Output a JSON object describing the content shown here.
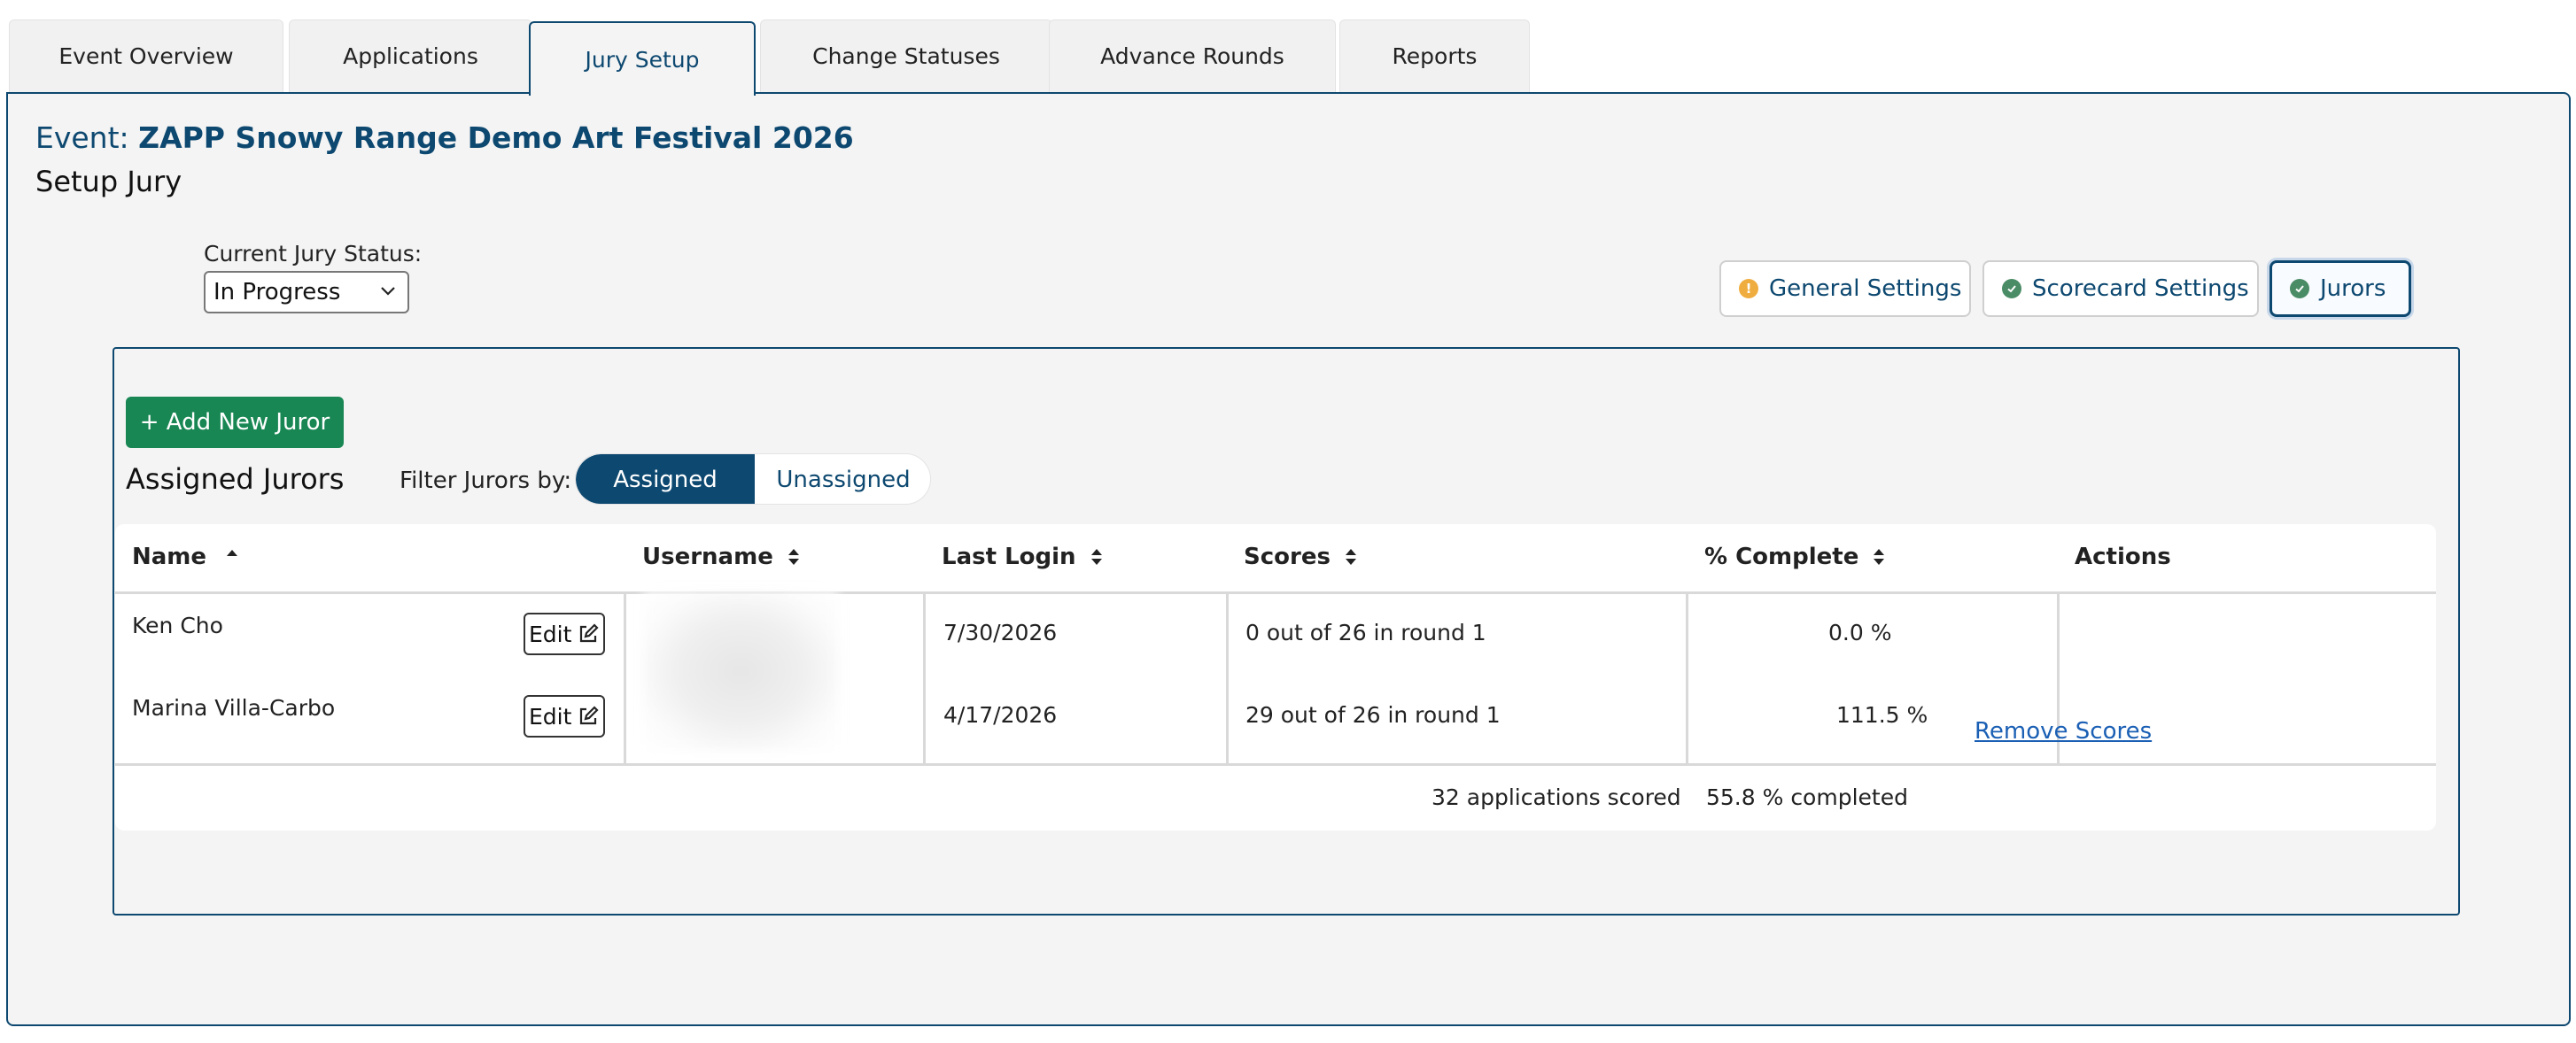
{
  "tabs": [
    {
      "label": "Event Overview"
    },
    {
      "label": "Applications"
    },
    {
      "label": "Jury Setup",
      "active": true
    },
    {
      "label": "Change Statuses"
    },
    {
      "label": "Advance Rounds"
    },
    {
      "label": "Reports"
    }
  ],
  "event": {
    "prefix": "Event:",
    "name": "ZAPP Snowy Range Demo Art Festival 2026",
    "subtitle": "Setup Jury"
  },
  "jury_status": {
    "label": "Current Jury Status:",
    "selected": "In Progress"
  },
  "setting_buttons": [
    {
      "label": "General Settings",
      "status": "warning"
    },
    {
      "label": "Scorecard Settings",
      "status": "complete"
    },
    {
      "label": "Jurors",
      "status": "complete",
      "active": true
    }
  ],
  "jurors": {
    "add_label": "+ Add New Juror",
    "title": "Assigned Jurors",
    "filter_label": "Filter Jurors by:",
    "filter_options": [
      "Assigned",
      "Unassigned"
    ],
    "filter_selected": "Assigned"
  },
  "table": {
    "headers": {
      "name": "Name",
      "username": "Username",
      "last_login": "Last Login",
      "scores": "Scores",
      "complete": "% Complete",
      "actions": "Actions"
    },
    "edit_label": "Edit",
    "rows": [
      {
        "name": "Ken Cho",
        "last_login": "7/30/2026",
        "scores": "0 out of 26 in round 1",
        "complete": "0.0 %",
        "action": ""
      },
      {
        "name": "Marina Villa-Carbo",
        "last_login": "4/17/2026",
        "scores": "29 out of 26 in round 1",
        "complete": "111.5 %",
        "action": "Remove Scores"
      }
    ],
    "footer": {
      "scored": "32 applications scored",
      "completed": "55.8 % completed"
    }
  },
  "colors": {
    "primary": "#0d4870",
    "success": "#198754",
    "warning": "#f0ad3f",
    "ok_dot": "#4a8c66",
    "link": "#1a5fb4"
  }
}
